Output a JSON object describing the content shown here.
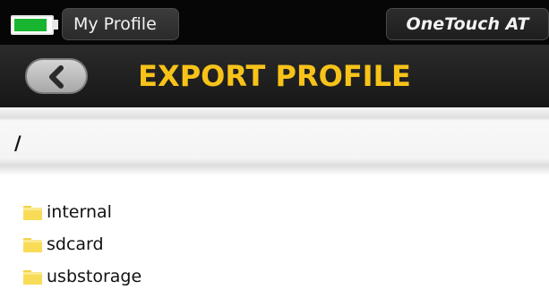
{
  "status_bar": {
    "battery_level": 0.9,
    "battery_color": "#19b530",
    "profile_label": "My Profile",
    "brand_label": "OneTouch AT"
  },
  "title_bar": {
    "back_icon": "chevron-left-icon",
    "title": "EXPORT PROFILE",
    "title_color": "#f7c319"
  },
  "path_bar": {
    "path": "/"
  },
  "file_list": {
    "items": [
      {
        "label": "internal",
        "icon": "folder-icon"
      },
      {
        "label": "sdcard",
        "icon": "folder-icon"
      },
      {
        "label": "usbstorage",
        "icon": "folder-icon"
      }
    ]
  }
}
